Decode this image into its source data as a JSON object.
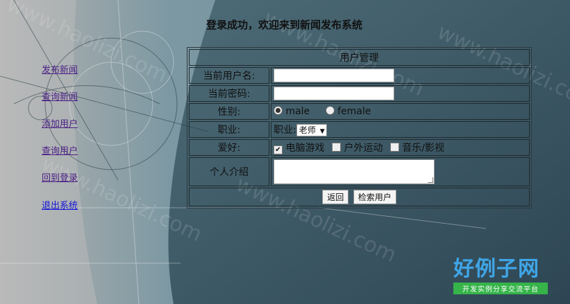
{
  "header": {
    "title": "登录成功，欢迎来到新闻发布系统"
  },
  "nav": {
    "items": [
      {
        "label": "发布新闻"
      },
      {
        "label": "查询新闻"
      },
      {
        "label": "添加用户"
      },
      {
        "label": "查询用户"
      },
      {
        "label": "回到登录"
      },
      {
        "label": "退出系统"
      }
    ]
  },
  "form": {
    "heading": "用户管理",
    "username_label": "当前用户名:",
    "username_value": "",
    "password_label": "当前密码:",
    "password_value": "",
    "gender_label": "性别:",
    "gender_options": [
      "male",
      "female"
    ],
    "gender_selected": "male",
    "job_label": "职业:",
    "job_inline_label": "职业:",
    "job_selected": "老师",
    "hobby_label": "爱好:",
    "hobbies": [
      {
        "label": "电脑游戏",
        "checked": true
      },
      {
        "label": "户外运动",
        "checked": false
      },
      {
        "label": "音乐/影视",
        "checked": false
      }
    ],
    "intro_label": "个人介绍",
    "intro_value": "",
    "back_button": "返回",
    "search_button": "检索用户"
  },
  "watermark": {
    "text": "www.haolizi.com",
    "logo_text": "好例子网",
    "logo_sub": "开发实例分享交流平台"
  },
  "colors": {
    "nav_link": "#4b1f86",
    "nav_link_last": "#1414d8",
    "logo_blue": "#3fa6e8",
    "logo_green": "#36b44a"
  }
}
